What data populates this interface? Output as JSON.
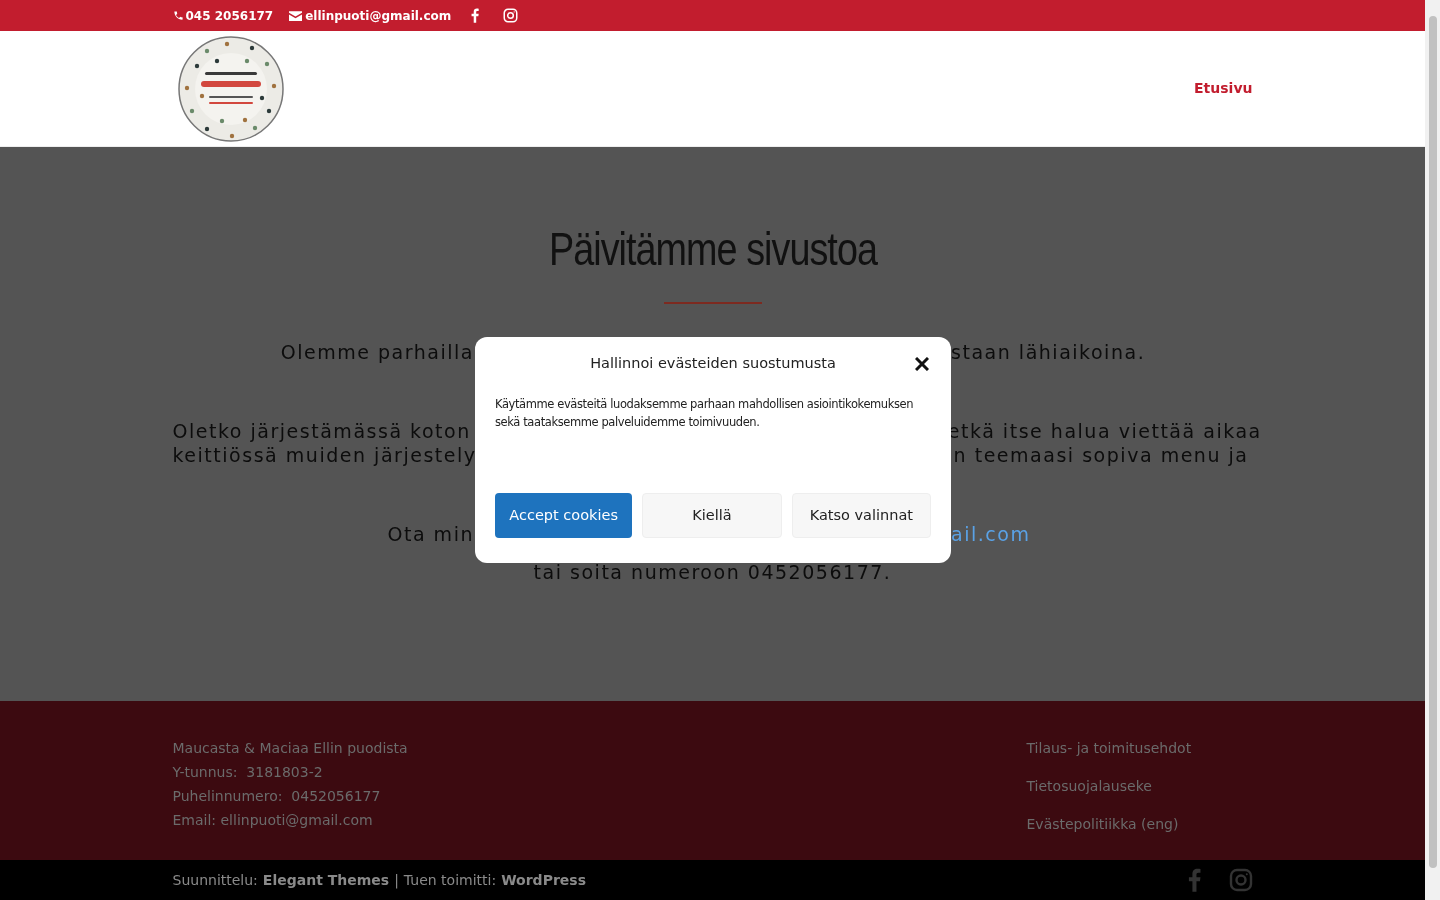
{
  "top_bar": {
    "phone": "045 2056177",
    "email": "ellinpuoti@gmail.com"
  },
  "header": {
    "nav": [
      {
        "label": "Etusivu",
        "selected": true
      }
    ]
  },
  "main": {
    "title": "Päivitämme sivustoa",
    "paragraphs": [
      {
        "lines": [
          {
            "left": "Olemme parhailla",
            "right": "staan lähiaikoina.",
            "right_link": false
          }
        ]
      },
      {
        "lines": [
          {
            "left": "Oletko järjestämässä koton",
            "right": "etkä itse halua viettää aikaa",
            "right_link": false
          },
          {
            "left": "keittiössä muiden järjestely",
            "right": "n teemaasi sopiva menu ja",
            "right_link": false
          }
        ]
      },
      {
        "lines": [
          {
            "left": "Ota min",
            "right": "ail.com",
            "right_link": true
          }
        ]
      }
    ],
    "last_line": "tai soita numeroon 0452056177."
  },
  "cookie_dialog": {
    "title": "Hallinnoi evästeiden suostumusta",
    "text": "Käytämme evästeitä luodaksemme parhaan mahdollisen asiointikokemuksen sekä taataksemme palveluidemme toimivuuden.",
    "buttons": [
      {
        "label": "Accept cookies",
        "kind": "primary"
      },
      {
        "label": "Kiellä",
        "kind": "secondary"
      },
      {
        "label": "Katso valinnat",
        "kind": "secondary"
      }
    ]
  },
  "footer": {
    "info": [
      "Maucasta & Maciaa Ellin puodista",
      "Y-tunnus:  3181803-2",
      "Puhelinnumero:  0452056177",
      "Email: ellinpuoti@gmail.com"
    ],
    "links": [
      "Tilaus- ja toimitusehdot",
      "Tietosuojalauseke",
      "Evästepolitiikka (eng)"
    ]
  },
  "bottom_bar": {
    "credit_prefix": "Suunnittelu:",
    "credit_theme": "Elegant Themes",
    "separator": "|",
    "powered_prefix": "Tuen toimitti:",
    "powered": "WordPress"
  }
}
